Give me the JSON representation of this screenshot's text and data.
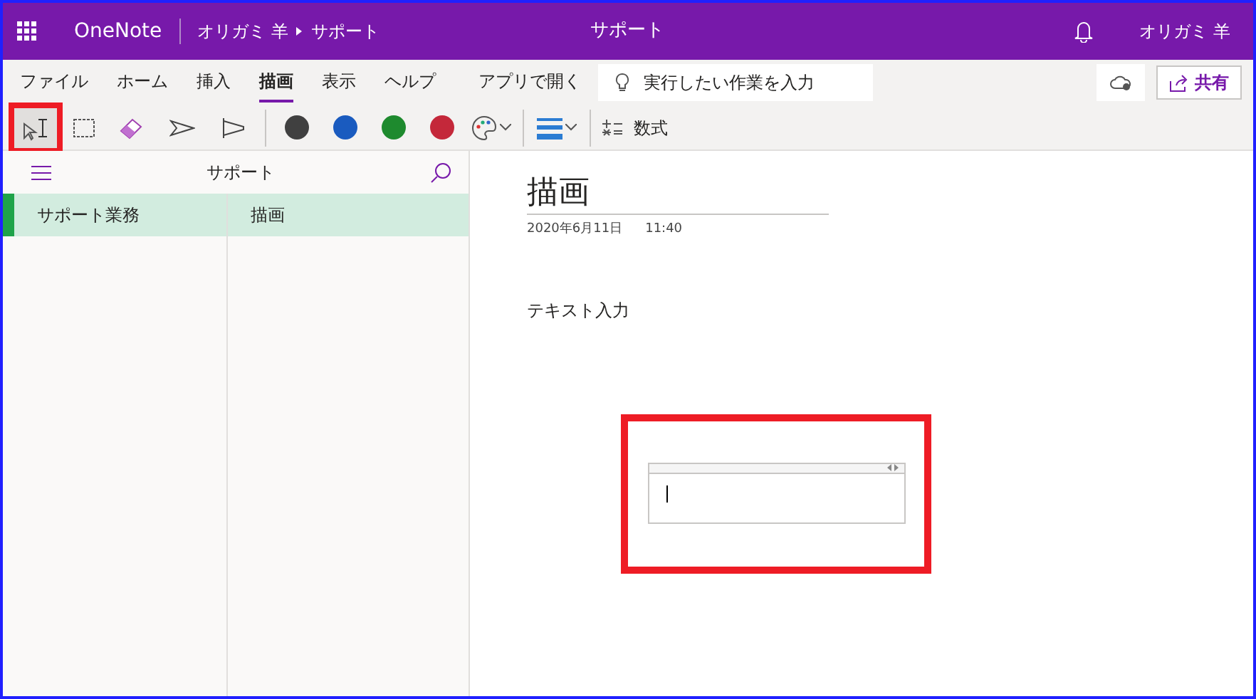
{
  "header": {
    "app_name": "OneNote",
    "breadcrumb": [
      "オリガミ 羊",
      "サポート"
    ],
    "title": "サポート",
    "user": "オリガミ 羊"
  },
  "ribbon_tabs": [
    {
      "label": "ファイル",
      "selected": false
    },
    {
      "label": "ホーム",
      "selected": false
    },
    {
      "label": "挿入",
      "selected": false
    },
    {
      "label": "描画",
      "selected": true
    },
    {
      "label": "表示",
      "selected": false
    },
    {
      "label": "ヘルプ",
      "selected": false
    },
    {
      "label": "アプリで開く",
      "selected": false
    }
  ],
  "search": {
    "placeholder": "実行したい作業を入力"
  },
  "share_button": "共有",
  "tools": [
    {
      "kind": "text-select",
      "selected": true
    },
    {
      "kind": "lasso",
      "selected": false
    },
    {
      "kind": "eraser",
      "selected": false
    },
    {
      "kind": "pen",
      "selected": false
    },
    {
      "kind": "highlighter",
      "selected": false
    },
    {
      "kind": "divider"
    },
    {
      "kind": "color",
      "color": "#404040",
      "selected": false
    },
    {
      "kind": "color",
      "color": "#1a5bbf",
      "selected": false
    },
    {
      "kind": "color",
      "color": "#1e8a2e",
      "selected": false
    },
    {
      "kind": "color",
      "color": "#c4283a",
      "selected": false
    },
    {
      "kind": "palette",
      "selected": false
    },
    {
      "kind": "divider"
    },
    {
      "kind": "thickness",
      "selected": false
    },
    {
      "kind": "divider"
    }
  ],
  "math_button": "数式",
  "notebook": {
    "title": "サポート",
    "sections": [
      {
        "label": "サポート業務",
        "selected": true,
        "color": "#1fa34a"
      }
    ],
    "pages": [
      {
        "label": "描画",
        "selected": true
      }
    ]
  },
  "page": {
    "title": "描画",
    "date": "2020年6月11日",
    "time": "11:40",
    "text": "テキスト入力",
    "text_box": {
      "focused": true
    }
  }
}
